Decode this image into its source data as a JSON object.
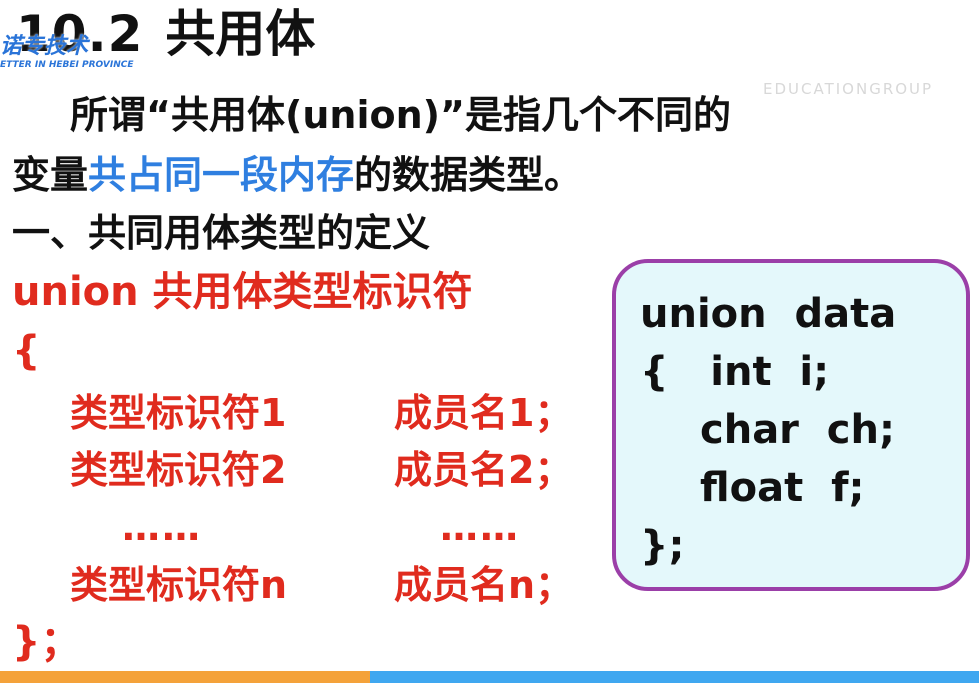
{
  "slide": {
    "title_num": "10.2",
    "title_text": "共用体",
    "logo_zh": "诺专技术",
    "logo_en": "ETTER IN HEBEI PROVINCE",
    "watermark": "EDUCATIONGROUP",
    "intro_1": "所谓“共用体(union)”是指几个不同的",
    "intro_2_a": "变量",
    "intro_2_b": "共占同一段内存",
    "intro_2_c": "的数据类型。",
    "section_heading": "一、共同用体类型的定义"
  },
  "syntax": {
    "header": "union  共用体类型标识符",
    "open_brace": "{",
    "members": [
      {
        "type": "类型标识符1",
        "name": "成员名1；"
      },
      {
        "type": "类型标识符2",
        "name": "成员名2；"
      },
      {
        "type": "类型标识符n",
        "name": "成员名n；"
      }
    ],
    "ellipsis": "……",
    "close": "}；"
  },
  "example": {
    "lines": [
      "union  data",
      "{   int  i;",
      "char  ch;",
      "float  f;",
      "};"
    ]
  },
  "colors": {
    "red": "#e02b1e",
    "blue": "#2f7fe0",
    "box_border": "#9b3fa8",
    "box_bg": "#e4f8fb"
  }
}
